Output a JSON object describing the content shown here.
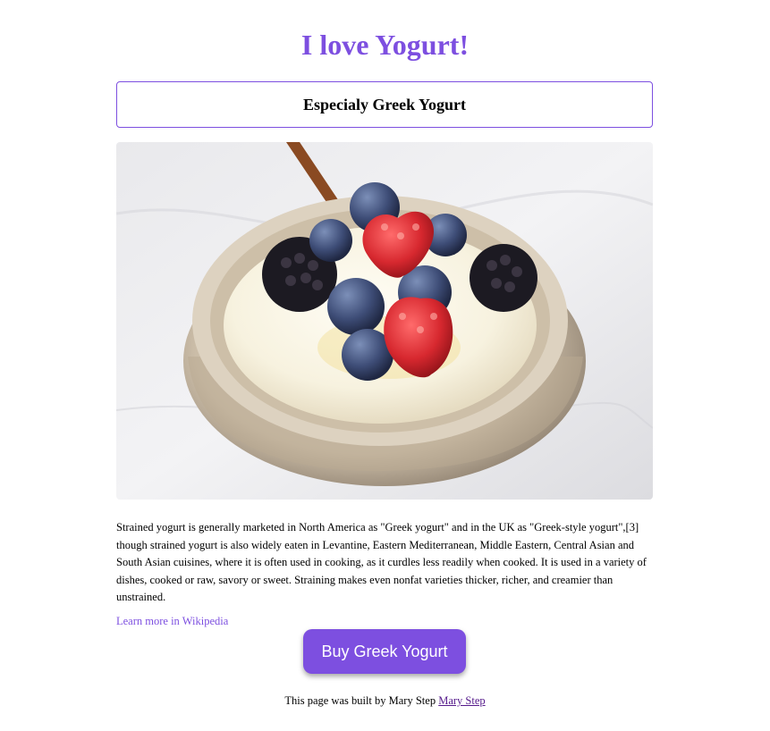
{
  "page": {
    "title": "I love Yogurt!",
    "subtitle": "Especialy Greek Yogurt",
    "description": "Strained yogurt is generally marketed in North America as \"Greek yogurt\" and in the UK as \"Greek-style yogurt\",[3] though strained yogurt is also widely eaten in Levantine, Eastern Mediterranean, Middle Eastern, Central Asian and South Asian cuisines, where it is often used in cooking, as it curdles less readily when cooked. It is used in a variety of dishes, cooked or raw, savory or sweet. Straining makes even nonfat varieties thicker, richer, and creamier than unstrained.",
    "learn_more_link": "Learn more in Wikipedia",
    "buy_button": "Buy Greek Yogurt",
    "footer_text": "This page was built by Mary Step ",
    "footer_link": "Mary Step"
  },
  "colors": {
    "accent": "#7d4fe0",
    "visited_link": "#551a8b"
  },
  "image": {
    "subject": "bowl of greek yogurt with blueberries, blackberries and raspberries"
  }
}
